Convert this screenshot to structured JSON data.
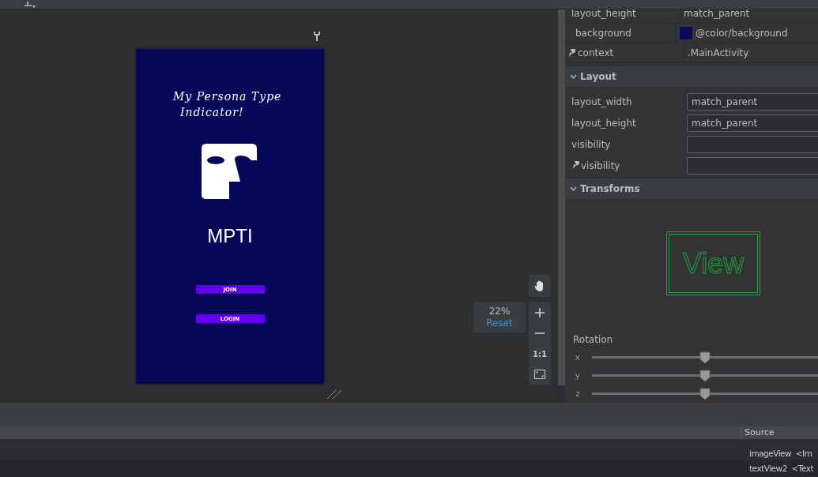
{
  "preview": {
    "title_lines": [
      "My Persona Type",
      "Indicator!"
    ],
    "app_name": "MPTI",
    "buttons": [
      "JOIN",
      "LOGIN"
    ]
  },
  "zoom": {
    "percent": "22%",
    "reset": "Reset",
    "actual_size": "1:1"
  },
  "attributes": [
    {
      "kind": "plain",
      "name": "layout_height",
      "value": "match_parent"
    },
    {
      "kind": "color",
      "name": "background",
      "value": "@color/background",
      "color": "#0a0a5e"
    },
    {
      "kind": "tool",
      "name": "context",
      "value": ".MainActivity"
    }
  ],
  "layout": {
    "title": "Layout",
    "expanded": true,
    "rows": [
      {
        "name": "layout_width",
        "value": "match_parent",
        "tool": false
      },
      {
        "name": "layout_height",
        "value": "match_parent",
        "tool": false
      },
      {
        "name": "visibility",
        "value": "",
        "tool": false
      },
      {
        "name": "visibility",
        "value": "",
        "tool": true
      }
    ]
  },
  "transforms": {
    "title": "Transforms",
    "expanded": true,
    "preview": "View",
    "rotation_label": "Rotation",
    "axes": [
      {
        "label": "x",
        "level": 0.5
      },
      {
        "label": "y",
        "level": 0.5
      },
      {
        "label": "z",
        "level": 0.5
      }
    ]
  },
  "components": {
    "source_header": "Source",
    "rows": [
      {
        "name": "imageView",
        "tag": "<Im"
      },
      {
        "name": "textView2",
        "tag": "<Text"
      }
    ]
  }
}
